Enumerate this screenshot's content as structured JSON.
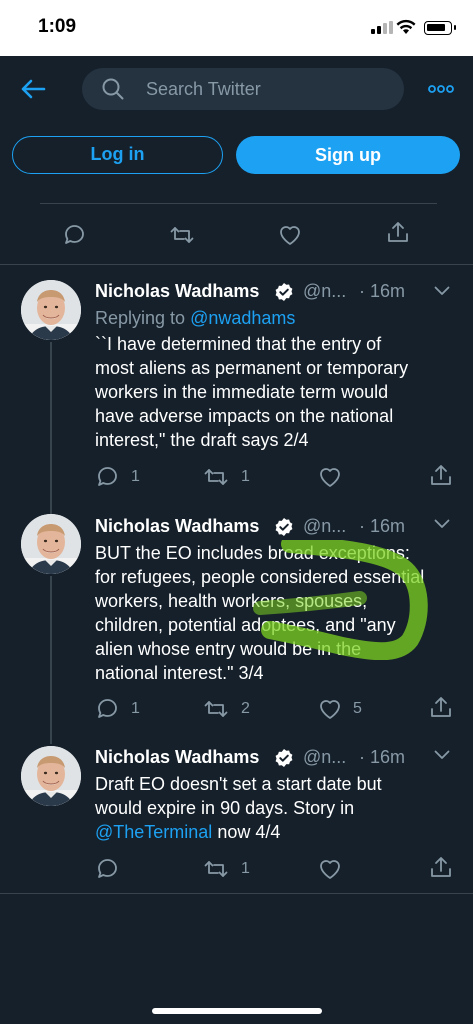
{
  "status_bar": {
    "time": "1:09"
  },
  "header": {
    "search_placeholder": "Search Twitter"
  },
  "auth": {
    "login_label": "Log in",
    "signup_label": "Sign up"
  },
  "tweets": [
    {
      "name": "Nicholas Wadhams",
      "handle": "@n...",
      "time": "· 16m",
      "reply_prefix": "Replying to ",
      "reply_mention": "@nwadhams",
      "lines": [
        "``I have determined that the entry of",
        "most aliens as permanent or temporary",
        "workers in the immediate term would",
        "have adverse impacts on the national",
        "interest,\" the draft says 2/4"
      ],
      "reply_count": "1",
      "retweet_count": "1",
      "like_count": ""
    },
    {
      "name": "Nicholas Wadhams",
      "handle": "@n...",
      "time": "· 16m",
      "lines": [
        "BUT the EO includes broad exceptions:",
        "for refugees, people considered essential",
        "workers, health workers, spouses,",
        "children, potential adoptees, and \"any",
        "alien whose entry would be in the",
        "national interest.\" 3/4"
      ],
      "reply_count": "1",
      "retweet_count": "2",
      "like_count": "5"
    },
    {
      "name": "Nicholas Wadhams",
      "handle": "@n...",
      "time": "· 16m",
      "line1": "Draft EO doesn't set a start date but",
      "line2": "would expire in 90 days. Story in",
      "line3_mention": "@TheTerminal",
      "line3_rest": " now 4/4",
      "reply_count": "",
      "retweet_count": "1",
      "like_count": ""
    }
  ],
  "icons": {
    "back": "arrow-left-icon",
    "search": "search-icon",
    "more": "more-icon",
    "reply": "reply-icon",
    "retweet": "retweet-icon",
    "like": "heart-icon",
    "share": "share-icon",
    "verified": "verified-badge-icon",
    "caret": "chevron-down-icon"
  },
  "colors": {
    "background": "#15202b",
    "accent": "#1da1f2",
    "secondary_text": "#8899a6",
    "divider": "#38444d",
    "highlight_mark": "#7ed321"
  }
}
